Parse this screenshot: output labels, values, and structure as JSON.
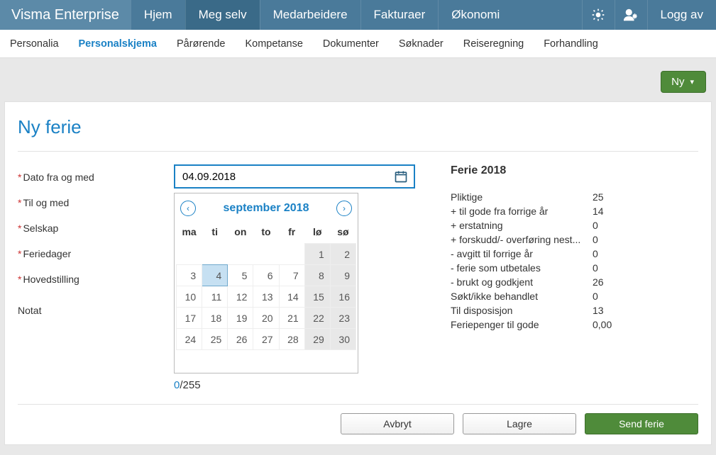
{
  "brand": "Visma Enterprise",
  "nav": {
    "items": [
      "Hjem",
      "Meg selv",
      "Medarbeidere",
      "Fakturaer",
      "Økonomi"
    ],
    "active_index": 1,
    "logoff": "Logg av"
  },
  "subnav": {
    "items": [
      "Personalia",
      "Personalskjema",
      "Pårørende",
      "Kompetanse",
      "Dokumenter",
      "Søknader",
      "Reiseregning",
      "Forhandling"
    ],
    "active_index": 1
  },
  "toolbar": {
    "new_label": "Ny"
  },
  "form": {
    "title": "Ny ferie",
    "labels": {
      "date_from": "Dato fra og med",
      "date_to": "Til og med",
      "company": "Selskap",
      "vac_days": "Feriedager",
      "main_pos": "Hovedstilling",
      "note": "Notat"
    },
    "date_from_value": "04.09.2018",
    "counter_current": "0",
    "counter_max": "/255"
  },
  "calendar": {
    "month_label": "september 2018",
    "dow": [
      "ma",
      "ti",
      "on",
      "to",
      "fr",
      "lø",
      "sø"
    ],
    "weeks": [
      [
        "",
        "",
        "",
        "",
        "",
        "1",
        "2"
      ],
      [
        "3",
        "4",
        "5",
        "6",
        "7",
        "8",
        "9"
      ],
      [
        "10",
        "11",
        "12",
        "13",
        "14",
        "15",
        "16"
      ],
      [
        "17",
        "18",
        "19",
        "20",
        "21",
        "22",
        "23"
      ],
      [
        "24",
        "25",
        "26",
        "27",
        "28",
        "29",
        "30"
      ]
    ],
    "selected": "4"
  },
  "summary": {
    "heading": "Ferie 2018",
    "rows": [
      {
        "label": "Pliktige",
        "value": "25"
      },
      {
        "label": "+ til gode fra forrige år",
        "value": "14"
      },
      {
        "label": "+ erstatning",
        "value": "0"
      },
      {
        "label": "+ forskudd/- overføring nest...",
        "value": "0"
      },
      {
        "label": "- avgitt til forrige år",
        "value": "0"
      },
      {
        "label": "- ferie som utbetales",
        "value": "0"
      },
      {
        "label": "- brukt og godkjent",
        "value": "26"
      },
      {
        "label": "Søkt/ikke behandlet",
        "value": "0"
      },
      {
        "label": "Til disposisjon",
        "value": "13"
      },
      {
        "label": "Feriepenger til gode",
        "value": "0,00"
      }
    ]
  },
  "footer": {
    "cancel": "Avbryt",
    "save": "Lagre",
    "send": "Send ferie"
  }
}
